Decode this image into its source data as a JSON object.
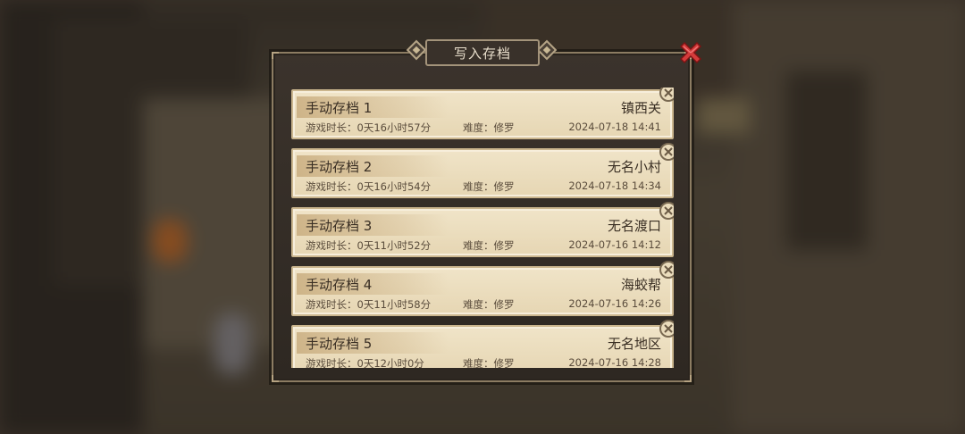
{
  "dialog": {
    "title": "写入存档",
    "close_icon": "close-x-icon",
    "accent_close": "#d43b3b"
  },
  "slots": [
    {
      "name": "手动存档 1",
      "location": "镇西关",
      "playtime": "游戏时长：0天16小时57分",
      "difficulty": "难度：修罗",
      "datetime": "2024-07-18 14:41"
    },
    {
      "name": "手动存档 2",
      "location": "无名小村",
      "playtime": "游戏时长：0天16小时54分",
      "difficulty": "难度：修罗",
      "datetime": "2024-07-18 14:34"
    },
    {
      "name": "手动存档 3",
      "location": "无名渡口",
      "playtime": "游戏时长：0天11小时52分",
      "difficulty": "难度：修罗",
      "datetime": "2024-07-16 14:12"
    },
    {
      "name": "手动存档 4",
      "location": "海蛟帮",
      "playtime": "游戏时长：0天11小时58分",
      "difficulty": "难度：修罗",
      "datetime": "2024-07-16 14:26"
    },
    {
      "name": "手动存档 5",
      "location": "无名地区",
      "playtime": "游戏时长：0天12小时0分",
      "difficulty": "难度：修罗",
      "datetime": "2024-07-16 14:28"
    }
  ]
}
